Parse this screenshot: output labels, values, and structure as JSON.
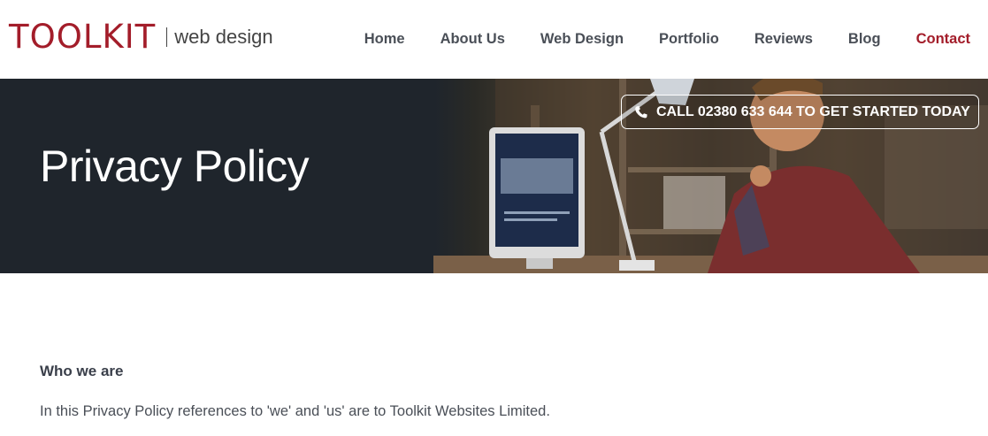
{
  "header": {
    "logo_main": "TOOLKIT",
    "logo_sub": "web design",
    "nav": [
      {
        "label": "Home",
        "active": false
      },
      {
        "label": "About Us",
        "active": false
      },
      {
        "label": "Web Design",
        "active": false
      },
      {
        "label": "Portfolio",
        "active": false
      },
      {
        "label": "Reviews",
        "active": false
      },
      {
        "label": "Blog",
        "active": false
      },
      {
        "label": "Contact",
        "active": true
      }
    ]
  },
  "hero": {
    "title": "Privacy Policy",
    "cta_label": "CALL 02380 633 644 TO GET STARTED TODAY",
    "cta_icon": "phone-icon"
  },
  "content": {
    "heading": "Who we are",
    "paragraph": "In this Privacy Policy references to 'we' and 'us' are to Toolkit Websites Limited."
  },
  "colors": {
    "brand": "#a31d2a",
    "hero_dark": "#1f252c",
    "text": "#3a3f4a"
  }
}
